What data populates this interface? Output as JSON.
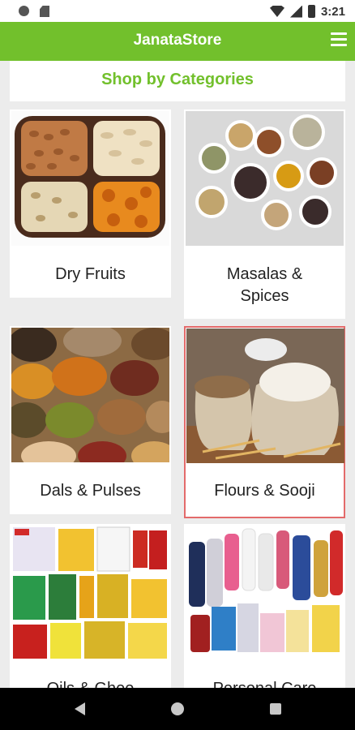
{
  "status_bar": {
    "time": "3:21"
  },
  "app_bar": {
    "title": "JanataStore"
  },
  "section": {
    "heading": "Shop by Categories"
  },
  "categories": [
    {
      "label": "Dry Fruits"
    },
    {
      "label": "Masalas &\nSpices"
    },
    {
      "label": "Dals & Pulses"
    },
    {
      "label": "Flours & Sooji",
      "selected": true
    },
    {
      "label": "Oils & Ghee"
    },
    {
      "label": "Personal Care"
    }
  ],
  "nav": {
    "back": "back-icon",
    "home": "home-icon",
    "recents": "recents-icon"
  },
  "colors": {
    "accent": "#72c02c",
    "selected_border": "#e36b6b"
  }
}
